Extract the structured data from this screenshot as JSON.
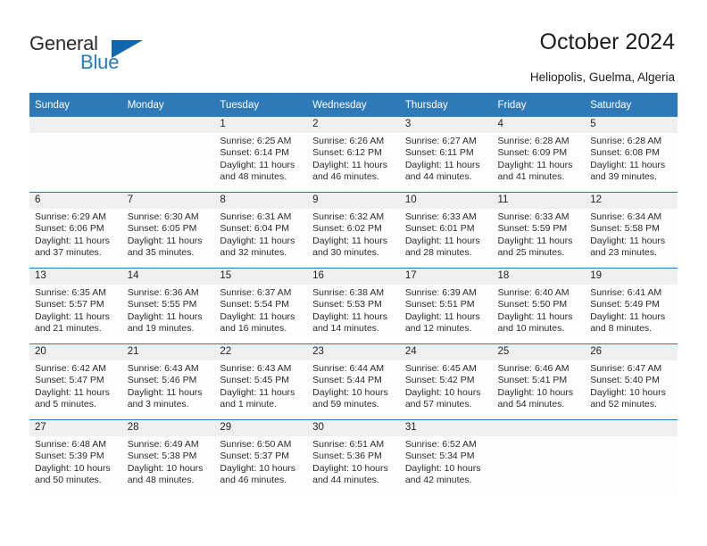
{
  "brand": {
    "name_part1": "General",
    "name_part2": "Blue",
    "triangle_color": "#1266ab",
    "blue_color": "#1f7dc0"
  },
  "header": {
    "title": "October 2024",
    "location": "Heliopolis, Guelma, Algeria"
  },
  "theme": {
    "header_blue": "#2e7ab8",
    "daynum_band": "#efefef",
    "cell_background": "#fdfdfd",
    "text": "#2a2a2a"
  },
  "weekday_headers": [
    "Sunday",
    "Monday",
    "Tuesday",
    "Wednesday",
    "Thursday",
    "Friday",
    "Saturday"
  ],
  "labels": {
    "sunrise_prefix": "Sunrise:",
    "sunset_prefix": "Sunset:",
    "daylight_prefix": "Daylight:"
  },
  "weeks": [
    [
      {
        "day": "",
        "sunrise": "",
        "sunset": "",
        "daylight": ""
      },
      {
        "day": "",
        "sunrise": "",
        "sunset": "",
        "daylight": ""
      },
      {
        "day": "1",
        "sunrise": "Sunrise: 6:25 AM",
        "sunset": "Sunset: 6:14 PM",
        "daylight": "Daylight: 11 hours and 48 minutes."
      },
      {
        "day": "2",
        "sunrise": "Sunrise: 6:26 AM",
        "sunset": "Sunset: 6:12 PM",
        "daylight": "Daylight: 11 hours and 46 minutes."
      },
      {
        "day": "3",
        "sunrise": "Sunrise: 6:27 AM",
        "sunset": "Sunset: 6:11 PM",
        "daylight": "Daylight: 11 hours and 44 minutes."
      },
      {
        "day": "4",
        "sunrise": "Sunrise: 6:28 AM",
        "sunset": "Sunset: 6:09 PM",
        "daylight": "Daylight: 11 hours and 41 minutes."
      },
      {
        "day": "5",
        "sunrise": "Sunrise: 6:28 AM",
        "sunset": "Sunset: 6:08 PM",
        "daylight": "Daylight: 11 hours and 39 minutes."
      }
    ],
    [
      {
        "day": "6",
        "sunrise": "Sunrise: 6:29 AM",
        "sunset": "Sunset: 6:06 PM",
        "daylight": "Daylight: 11 hours and 37 minutes."
      },
      {
        "day": "7",
        "sunrise": "Sunrise: 6:30 AM",
        "sunset": "Sunset: 6:05 PM",
        "daylight": "Daylight: 11 hours and 35 minutes."
      },
      {
        "day": "8",
        "sunrise": "Sunrise: 6:31 AM",
        "sunset": "Sunset: 6:04 PM",
        "daylight": "Daylight: 11 hours and 32 minutes."
      },
      {
        "day": "9",
        "sunrise": "Sunrise: 6:32 AM",
        "sunset": "Sunset: 6:02 PM",
        "daylight": "Daylight: 11 hours and 30 minutes."
      },
      {
        "day": "10",
        "sunrise": "Sunrise: 6:33 AM",
        "sunset": "Sunset: 6:01 PM",
        "daylight": "Daylight: 11 hours and 28 minutes."
      },
      {
        "day": "11",
        "sunrise": "Sunrise: 6:33 AM",
        "sunset": "Sunset: 5:59 PM",
        "daylight": "Daylight: 11 hours and 25 minutes."
      },
      {
        "day": "12",
        "sunrise": "Sunrise: 6:34 AM",
        "sunset": "Sunset: 5:58 PM",
        "daylight": "Daylight: 11 hours and 23 minutes."
      }
    ],
    [
      {
        "day": "13",
        "sunrise": "Sunrise: 6:35 AM",
        "sunset": "Sunset: 5:57 PM",
        "daylight": "Daylight: 11 hours and 21 minutes."
      },
      {
        "day": "14",
        "sunrise": "Sunrise: 6:36 AM",
        "sunset": "Sunset: 5:55 PM",
        "daylight": "Daylight: 11 hours and 19 minutes."
      },
      {
        "day": "15",
        "sunrise": "Sunrise: 6:37 AM",
        "sunset": "Sunset: 5:54 PM",
        "daylight": "Daylight: 11 hours and 16 minutes."
      },
      {
        "day": "16",
        "sunrise": "Sunrise: 6:38 AM",
        "sunset": "Sunset: 5:53 PM",
        "daylight": "Daylight: 11 hours and 14 minutes."
      },
      {
        "day": "17",
        "sunrise": "Sunrise: 6:39 AM",
        "sunset": "Sunset: 5:51 PM",
        "daylight": "Daylight: 11 hours and 12 minutes."
      },
      {
        "day": "18",
        "sunrise": "Sunrise: 6:40 AM",
        "sunset": "Sunset: 5:50 PM",
        "daylight": "Daylight: 11 hours and 10 minutes."
      },
      {
        "day": "19",
        "sunrise": "Sunrise: 6:41 AM",
        "sunset": "Sunset: 5:49 PM",
        "daylight": "Daylight: 11 hours and 8 minutes."
      }
    ],
    [
      {
        "day": "20",
        "sunrise": "Sunrise: 6:42 AM",
        "sunset": "Sunset: 5:47 PM",
        "daylight": "Daylight: 11 hours and 5 minutes."
      },
      {
        "day": "21",
        "sunrise": "Sunrise: 6:43 AM",
        "sunset": "Sunset: 5:46 PM",
        "daylight": "Daylight: 11 hours and 3 minutes."
      },
      {
        "day": "22",
        "sunrise": "Sunrise: 6:43 AM",
        "sunset": "Sunset: 5:45 PM",
        "daylight": "Daylight: 11 hours and 1 minute."
      },
      {
        "day": "23",
        "sunrise": "Sunrise: 6:44 AM",
        "sunset": "Sunset: 5:44 PM",
        "daylight": "Daylight: 10 hours and 59 minutes."
      },
      {
        "day": "24",
        "sunrise": "Sunrise: 6:45 AM",
        "sunset": "Sunset: 5:42 PM",
        "daylight": "Daylight: 10 hours and 57 minutes."
      },
      {
        "day": "25",
        "sunrise": "Sunrise: 6:46 AM",
        "sunset": "Sunset: 5:41 PM",
        "daylight": "Daylight: 10 hours and 54 minutes."
      },
      {
        "day": "26",
        "sunrise": "Sunrise: 6:47 AM",
        "sunset": "Sunset: 5:40 PM",
        "daylight": "Daylight: 10 hours and 52 minutes."
      }
    ],
    [
      {
        "day": "27",
        "sunrise": "Sunrise: 6:48 AM",
        "sunset": "Sunset: 5:39 PM",
        "daylight": "Daylight: 10 hours and 50 minutes."
      },
      {
        "day": "28",
        "sunrise": "Sunrise: 6:49 AM",
        "sunset": "Sunset: 5:38 PM",
        "daylight": "Daylight: 10 hours and 48 minutes."
      },
      {
        "day": "29",
        "sunrise": "Sunrise: 6:50 AM",
        "sunset": "Sunset: 5:37 PM",
        "daylight": "Daylight: 10 hours and 46 minutes."
      },
      {
        "day": "30",
        "sunrise": "Sunrise: 6:51 AM",
        "sunset": "Sunset: 5:36 PM",
        "daylight": "Daylight: 10 hours and 44 minutes."
      },
      {
        "day": "31",
        "sunrise": "Sunrise: 6:52 AM",
        "sunset": "Sunset: 5:34 PM",
        "daylight": "Daylight: 10 hours and 42 minutes."
      },
      {
        "day": "",
        "sunrise": "",
        "sunset": "",
        "daylight": ""
      },
      {
        "day": "",
        "sunrise": "",
        "sunset": "",
        "daylight": ""
      }
    ]
  ]
}
